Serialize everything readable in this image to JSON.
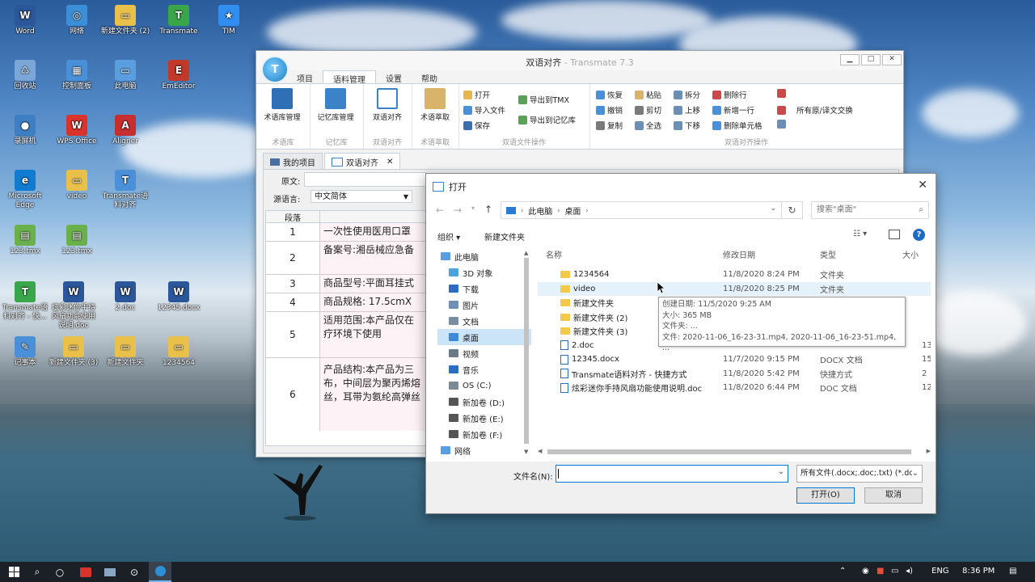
{
  "desktop": {
    "icons": [
      {
        "label": "Word",
        "color": "#2b579a",
        "glyph": "W"
      },
      {
        "label": "网络",
        "color": "#3a8fd6",
        "glyph": "◎"
      },
      {
        "label": "新建文件夹 (2)",
        "color": "#e8c04a",
        "glyph": "▭"
      },
      {
        "label": "Transmate",
        "color": "#3aa64a",
        "glyph": "T"
      },
      {
        "label": "TIM",
        "color": "#2f8ef0",
        "glyph": "★"
      },
      {
        "label": "回收站",
        "color": "#7aa7d8",
        "glyph": "♺"
      },
      {
        "label": "控制面板",
        "color": "#4a90d9",
        "glyph": "▦"
      },
      {
        "label": "此电脑",
        "color": "#5a9ee0",
        "glyph": "▭"
      },
      {
        "label": "EmEditor",
        "color": "#c0392b",
        "glyph": "E"
      },
      {
        "label": "录屏机",
        "color": "#3d7fc2",
        "glyph": "●"
      },
      {
        "label": "WPS Office",
        "color": "#d9342b",
        "glyph": "W"
      },
      {
        "label": "Aligner",
        "color": "#c72f2f",
        "glyph": "A"
      },
      {
        "label": "Microsoft Edge",
        "color": "#0f7bd1",
        "glyph": "e"
      },
      {
        "label": "video",
        "color": "#e8c04a",
        "glyph": "▭"
      },
      {
        "label": "Transmate语料对齐",
        "color": "#4a90d9",
        "glyph": "T"
      },
      {
        "label": "123.tmx",
        "color": "#6ab04c",
        "glyph": "▤"
      },
      {
        "label": "123.tmx",
        "color": "#6ab04c",
        "glyph": "▤"
      },
      {
        "label": "Transmate语料对齐 - 快...",
        "color": "#3aa64a",
        "glyph": "T"
      },
      {
        "label": "炫彩迷你手持风扇功能使用说明.doc",
        "color": "#2b579a",
        "glyph": "W"
      },
      {
        "label": "2.doc",
        "color": "#2b579a",
        "glyph": "W"
      },
      {
        "label": "12345.docx",
        "color": "#2b579a",
        "glyph": "W"
      },
      {
        "label": "记事本",
        "color": "#4a90d9",
        "glyph": "✎"
      },
      {
        "label": "新建文件夹 (3)",
        "color": "#e8c04a",
        "glyph": "▭"
      },
      {
        "label": "新建文件夹",
        "color": "#e8c04a",
        "glyph": "▭"
      },
      {
        "label": "1234564",
        "color": "#e8c04a",
        "glyph": "▭"
      }
    ]
  },
  "app": {
    "logo": "T",
    "title": "双语对齐",
    "subtitle": "- Transmate 7.3",
    "controls": [
      "▁",
      "□",
      "✕"
    ],
    "menu_tabs": [
      "项目",
      "语料管理",
      "设置",
      "帮助"
    ],
    "ribbon": {
      "big_buttons": [
        "术语库管理",
        "记忆库管理",
        "双语对齐",
        "术语萃取"
      ],
      "group_labels": [
        "术语库",
        "记忆库",
        "双语对齐",
        "术语萃取",
        "双语文件操作",
        "双语对齐操作"
      ],
      "file_ops": [
        "打开",
        "导入文件",
        "保存",
        "导出到TMX",
        "导出到记忆库"
      ],
      "align_ops": [
        "恢复",
        "粘贴",
        "拆分",
        "删除行",
        "撤销",
        "剪切",
        "上移",
        "新增一行",
        "复制",
        "全选",
        "下移",
        "删除单元格",
        "所有原/译文交换"
      ]
    },
    "doc_tabs": [
      "我的项目",
      "双语对齐"
    ],
    "doc_tab_close": "✕",
    "panel": {
      "source_label": "原文:",
      "source_lang_label": "源语言:",
      "source_lang_value": "中文简体",
      "table_header": "段落",
      "rows": [
        {
          "n": "1",
          "text": "一次性使用医用口罩"
        },
        {
          "n": "2",
          "text": "备案号:湘岳械应急备"
        },
        {
          "n": "3",
          "text": "商品型号:平面耳挂式"
        },
        {
          "n": "4",
          "text": "商品规格: 17.5cmX"
        },
        {
          "n": "5",
          "text": "适用范围:本产品仅在",
          "text2": "疗环境下使用"
        },
        {
          "n": "6",
          "text": "产品结构:本产品为三",
          "text2": "布，中间层为聚丙烯熔",
          "text3": "丝，耳带为氨纶高弹丝"
        }
      ]
    }
  },
  "dialog": {
    "title": "打开",
    "close": "✕",
    "nav_back": "←",
    "nav_forward": "→",
    "nav_up": "↑",
    "breadcrumb": [
      "此电脑",
      "桌面"
    ],
    "refresh": "↻",
    "search_placeholder": "搜索\"桌面\"",
    "toolbar": {
      "organize": "组织 ▾",
      "new_folder": "新建文件夹"
    },
    "nav_items": [
      {
        "label": "此电脑",
        "color": "#5a9ee0"
      },
      {
        "label": "3D 对象",
        "color": "#4aa3df"
      },
      {
        "label": "下载",
        "color": "#2b6cc4"
      },
      {
        "label": "图片",
        "color": "#6c8fb3"
      },
      {
        "label": "文档",
        "color": "#7a8da0"
      },
      {
        "label": "桌面",
        "color": "#3d8ad8"
      },
      {
        "label": "视频",
        "color": "#6c7a88"
      },
      {
        "label": "音乐",
        "color": "#2b6cc4"
      },
      {
        "label": "OS (C:)",
        "color": "#7d8a96"
      },
      {
        "label": "新加卷 (D:)",
        "color": "#555"
      },
      {
        "label": "新加卷 (E:)",
        "color": "#555"
      },
      {
        "label": "新加卷 (F:)",
        "color": "#555"
      },
      {
        "label": "网络",
        "color": "#5a9ee0"
      }
    ],
    "columns": [
      "名称",
      "修改日期",
      "类型",
      "大小"
    ],
    "files": [
      {
        "name": "1234564",
        "date": "11/8/2020 8:24 PM",
        "type": "文件夹",
        "size": "",
        "kind": "folder"
      },
      {
        "name": "video",
        "date": "11/8/2020 8:25 PM",
        "type": "文件夹",
        "size": "",
        "kind": "folder"
      },
      {
        "name": "新建文件夹",
        "date": "",
        "type": "",
        "size": "",
        "kind": "folder"
      },
      {
        "name": "新建文件夹 (2)",
        "date": "",
        "type": "",
        "size": "",
        "kind": "folder"
      },
      {
        "name": "新建文件夹 (3)",
        "date": "",
        "type": "",
        "size": "",
        "kind": "folder"
      },
      {
        "name": "2.doc",
        "date": "",
        "type": "",
        "size": "13",
        "kind": "doc"
      },
      {
        "name": "12345.docx",
        "date": "11/7/2020 9:15 PM",
        "type": "DOCX 文档",
        "size": "15",
        "kind": "doc"
      },
      {
        "name": "Transmate语料对齐 - 快捷方式",
        "date": "11/8/2020 5:42 PM",
        "type": "快捷方式",
        "size": "2",
        "kind": "link"
      },
      {
        "name": "炫彩迷你手持风扇功能使用说明.doc",
        "date": "11/8/2020 6:44 PM",
        "type": "DOC 文档",
        "size": "12",
        "kind": "doc"
      }
    ],
    "tooltip": {
      "created": "创建日期: 11/5/2020 9:25 AM",
      "size": "大小: 365 MB",
      "folders": "文件夹: ...",
      "files": "文件: 2020-11-06_16-23-31.mp4, 2020-11-06_16-23-51.mp4, ..."
    },
    "filename_label": "文件名(N):",
    "filename_value": "",
    "filetype_value": "所有文件(.docx;.doc;.txt) (*.dc",
    "open_button": "打开(O)",
    "cancel_button": "取消"
  },
  "taskbar": {
    "lang": "ENG",
    "time": "8:36 PM"
  }
}
